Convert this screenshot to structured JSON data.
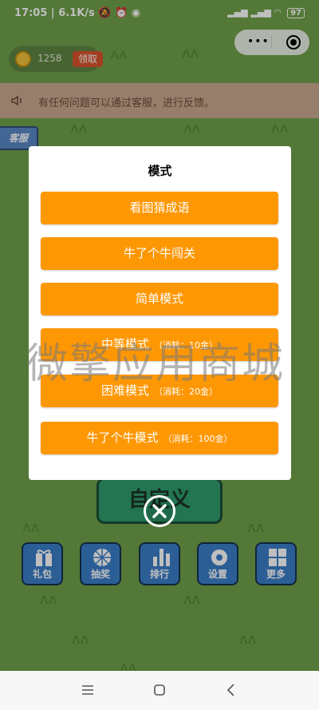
{
  "status_bar": {
    "time": "17:05",
    "speed": "6.1K/s",
    "battery": "97"
  },
  "top": {
    "coin_count": "1258",
    "claim_label": "领取"
  },
  "notice": {
    "text": "有任何问题可以通过客服，进行反馈。"
  },
  "service_tab": {
    "label": "客服"
  },
  "background": {
    "custom_button_label": "自定义"
  },
  "modal": {
    "title": "模式",
    "modes": [
      {
        "label": "看图猜成语",
        "cost": ""
      },
      {
        "label": "牛了个牛闯关",
        "cost": ""
      },
      {
        "label": "简单模式",
        "cost": ""
      },
      {
        "label": "中等模式",
        "cost": "（消耗：10金）"
      },
      {
        "label": "困难模式",
        "cost": "（消耗：20金）"
      },
      {
        "label": "牛了个牛模式",
        "cost": "（消耗：100金）"
      }
    ]
  },
  "bottom_menu": [
    {
      "label": "礼包",
      "icon": "gift-icon"
    },
    {
      "label": "抽奖",
      "icon": "wheel-icon"
    },
    {
      "label": "排行",
      "icon": "bar-chart-icon"
    },
    {
      "label": "设置",
      "icon": "gear-icon"
    },
    {
      "label": "更多",
      "icon": "grid-icon"
    }
  ],
  "watermark": "微擎应用商城",
  "colors": {
    "accent": "#fe9704",
    "background": "#6fa14a",
    "menu_blue": "#3b7ec8"
  }
}
